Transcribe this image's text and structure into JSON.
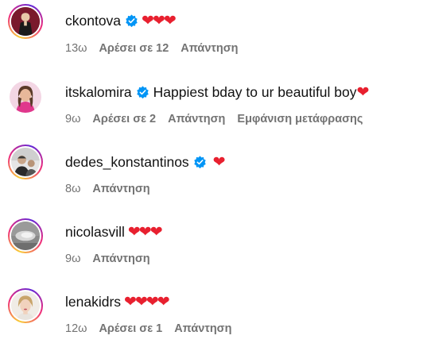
{
  "comments": [
    {
      "username": "ckontova",
      "verified": true,
      "text": "",
      "emoji": "❤❤❤",
      "time": "13ω",
      "likes": "Αρέσει σε 12",
      "reply": "Απάντηση",
      "translate": "",
      "avatar_icon": "avatar-photo"
    },
    {
      "username": "itskalomira",
      "verified": true,
      "text": "Happiest bday to ur beautiful boy",
      "emoji": "❤",
      "time": "9ω",
      "likes": "Αρέσει σε 2",
      "reply": "Απάντηση",
      "translate": "Εμφάνιση μετάφρασης",
      "avatar_icon": "avatar-photo"
    },
    {
      "username": "dedes_konstantinos",
      "verified": true,
      "text": "",
      "emoji": "❤",
      "time": "8ω",
      "likes": "",
      "reply": "Απάντηση",
      "translate": "",
      "avatar_icon": "avatar-photo"
    },
    {
      "username": "nicolasvill",
      "verified": false,
      "text": "",
      "emoji": "❤❤❤",
      "time": "9ω",
      "likes": "",
      "reply": "Απάντηση",
      "translate": "",
      "avatar_icon": "avatar-photo"
    },
    {
      "username": "lenakidrs",
      "verified": false,
      "text": "",
      "emoji": "❤❤❤❤",
      "time": "12ω",
      "likes": "Αρέσει σε 1",
      "reply": "Απάντηση",
      "translate": "",
      "avatar_icon": "avatar-photo"
    }
  ],
  "colors": {
    "heart": "#e8202f",
    "verified_badge": "#0095f6",
    "meta_text": "#737373"
  }
}
